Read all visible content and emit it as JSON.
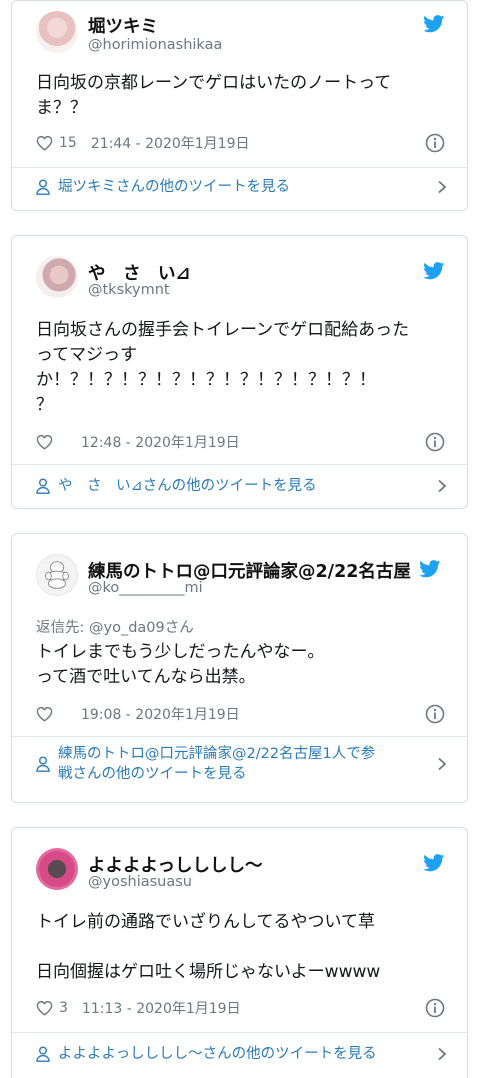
{
  "tweets": [
    {
      "display_name": "堀ツキミ",
      "handle": "@horimionashikaa",
      "reply_to": "",
      "text_lines": [
        "日向坂の京都レーンでゲロはいたのノートって",
        "ま？？"
      ],
      "likes": "15",
      "timestamp": "21:44 - 2020年1月19日",
      "more_lines": [
        "堀ツキミさんの他のツイートを見る"
      ]
    },
    {
      "display_name": "や　さ　い⊿",
      "handle": "@tkskymnt",
      "reply_to": "",
      "text_lines": [
        "日向坂さんの握手会トイレーンでゲロ配給あった",
        "ってマジっす",
        "か！？！？！？！？！？！？！？！？！？！",
        "？"
      ],
      "likes": "",
      "timestamp": "12:48 - 2020年1月19日",
      "more_lines": [
        "や　さ　い⊿さんの他のツイートを見る"
      ]
    },
    {
      "display_name": "練馬のトトロ@口元評論家@2/22名古屋",
      "handle": "@ko_________mi",
      "reply_to": "返信先: @yo_da09さん",
      "text_lines": [
        "トイレまでもう少しだったんやなー。",
        "って酒で吐いてんなら出禁。"
      ],
      "likes": "",
      "timestamp": "19:08 - 2020年1月19日",
      "more_lines": [
        "練馬のトトロ@口元評論家@2/22名古屋1人で参",
        "戦さんの他のツイートを見る"
      ]
    },
    {
      "display_name": "よよよよっしししし〜",
      "handle": "@yoshiasuasu",
      "reply_to": "",
      "text_lines": [
        "トイレ前の通路でいざりんしてるやついて草",
        "",
        "日向個握はゲロ吐く場所じゃないよーwwww"
      ],
      "likes": "3",
      "timestamp": "11:13 - 2020年1月19日",
      "more_lines": [
        "よよよよっしししし〜さんの他のツイートを見る"
      ]
    }
  ],
  "icons": {
    "brand": "twitter-bird-icon",
    "like": "heart-icon",
    "info": "info-icon",
    "profile": "person-icon",
    "chevron": "chevron-right-icon"
  },
  "colors": {
    "brand": "#1da1f2",
    "link": "#2b7bb9",
    "muted": "#697882",
    "border": "#d6dde3"
  }
}
